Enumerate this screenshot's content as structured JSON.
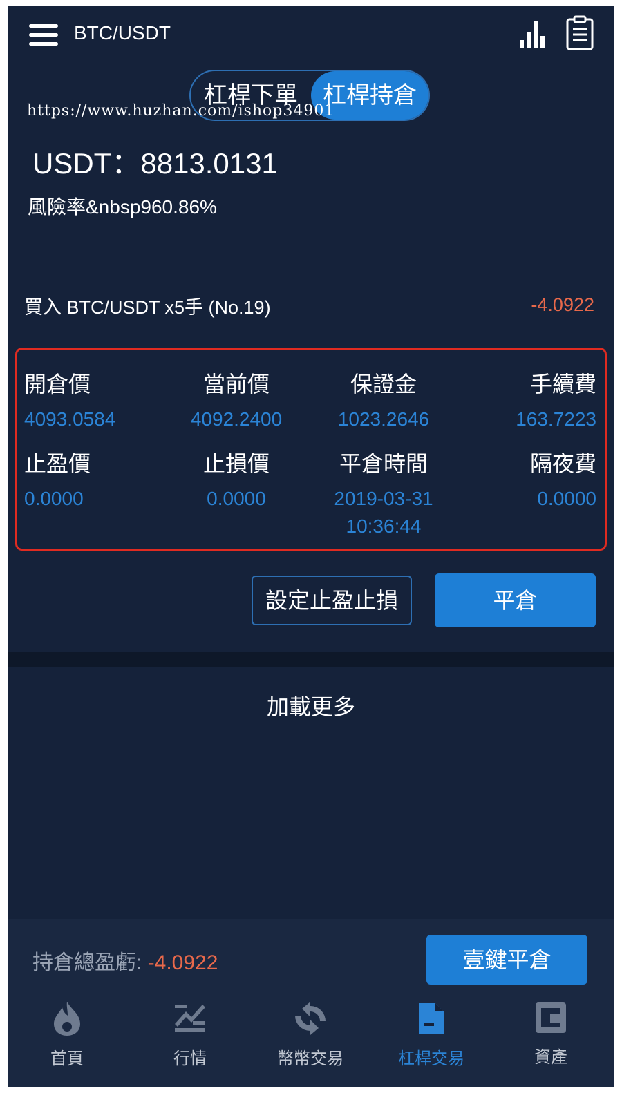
{
  "header": {
    "title": "BTC/USDT"
  },
  "tabs": [
    {
      "label": "杠桿下單",
      "active": false
    },
    {
      "label": "杠桿持倉",
      "active": true
    }
  ],
  "watermark": "https://www.huzhan.com/ishop34901",
  "account": {
    "balance": "USDT：8813.0131",
    "risk": "風險率&nbsp960.86%"
  },
  "position": {
    "title": "買入  BTC/USDT x5手  (No.19)",
    "pnl": "-4.0922",
    "fields": {
      "open_price": {
        "label": "開倉價",
        "value": "4093.0584"
      },
      "current_price": {
        "label": "當前價",
        "value": "4092.2400"
      },
      "margin": {
        "label": "保證金",
        "value": "1023.2646"
      },
      "fee": {
        "label": "手續費",
        "value": "163.7223"
      },
      "take_profit": {
        "label": "止盈價",
        "value": "0.0000"
      },
      "stop_loss": {
        "label": "止損價",
        "value": "0.0000"
      },
      "close_time": {
        "label": "平倉時間",
        "value": "2019-03-31 10:36:44"
      },
      "overnight_fee": {
        "label": "隔夜費",
        "value": "0.0000"
      }
    },
    "buttons": {
      "set_tp_sl": "設定止盈止損",
      "close": "平倉"
    }
  },
  "load_more": "加載更多",
  "footer": {
    "total_label": "持倉總盈虧: ",
    "total_value": "-4.0922",
    "close_all": "壹鍵平倉"
  },
  "nav": [
    {
      "label": "首頁",
      "icon": "flame-icon",
      "active": false
    },
    {
      "label": "行情",
      "icon": "market-icon",
      "active": false
    },
    {
      "label": "幣幣交易",
      "icon": "exchange-icon",
      "active": false
    },
    {
      "label": "杠桿交易",
      "icon": "leverage-icon",
      "active": true
    },
    {
      "label": "資產",
      "icon": "wallet-icon",
      "active": false
    }
  ],
  "colors": {
    "background": "#15223a",
    "accent": "#1e7fd6",
    "value_blue": "#2b84d6",
    "negative": "#e8694b",
    "highlight_border": "#e02b21"
  }
}
